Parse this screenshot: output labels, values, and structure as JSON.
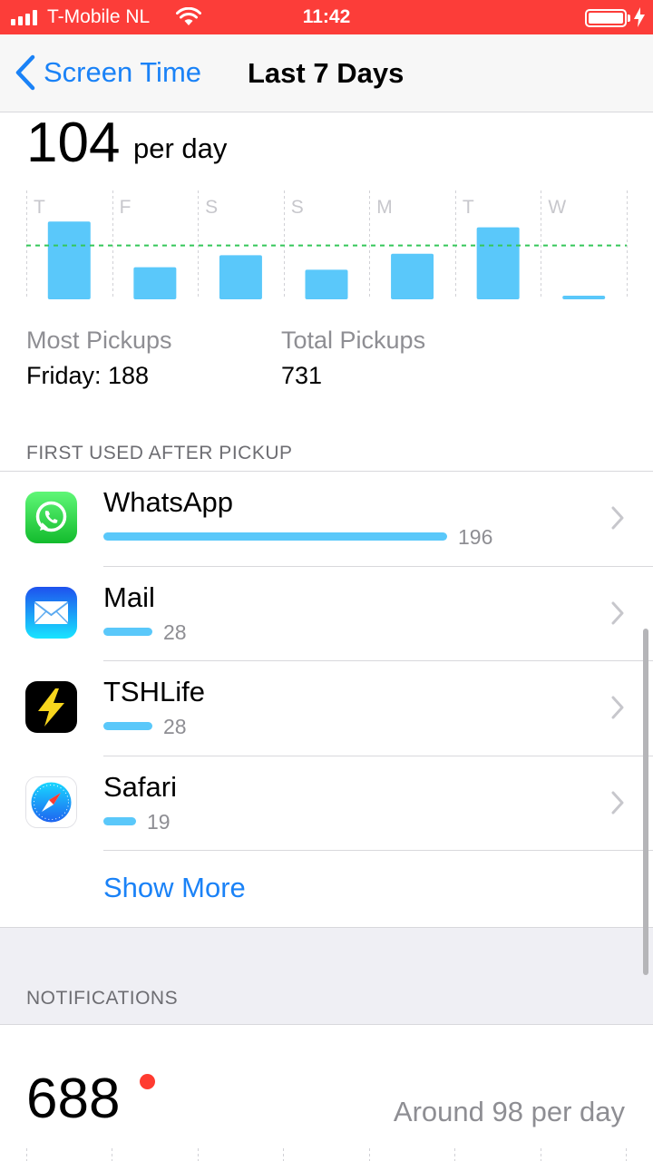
{
  "status_bar": {
    "carrier": "T-Mobile NL",
    "time": "11:42",
    "background_color": "#fc3d39"
  },
  "nav": {
    "back_label": "Screen Time",
    "title": "Last 7 Days"
  },
  "pickups": {
    "average": "104",
    "average_unit": "per day",
    "most_label": "Most Pickups",
    "most_value": "Friday: 188",
    "total_label": "Total Pickups",
    "total_value": "731"
  },
  "chart_data": {
    "type": "bar",
    "categories": [
      "T",
      "F",
      "S",
      "S",
      "M",
      "T",
      "W"
    ],
    "values": [
      150,
      62,
      85,
      57,
      88,
      139,
      7
    ],
    "average_line": 104,
    "ylim": [
      0,
      210
    ],
    "bar_color": "#5ac8fa",
    "average_line_color": "#34c759"
  },
  "first_used": {
    "header": "FIRST USED AFTER PICKUP",
    "apps": [
      {
        "name": "WhatsApp",
        "count": "196",
        "icon": "whatsapp-icon"
      },
      {
        "name": "Mail",
        "count": "28",
        "icon": "mail-icon"
      },
      {
        "name": "TSHLife",
        "count": "28",
        "icon": "lightning-icon"
      },
      {
        "name": "Safari",
        "count": "19",
        "icon": "safari-compass-icon"
      }
    ],
    "show_more": "Show More"
  },
  "notifications": {
    "header": "NOTIFICATIONS",
    "total": "688",
    "average": "Around 98 per day"
  },
  "colors": {
    "accent": "#1a82f7",
    "bar": "#5ac8fa",
    "secondary_text": "#8e8e93",
    "badge": "#ff3b30"
  }
}
